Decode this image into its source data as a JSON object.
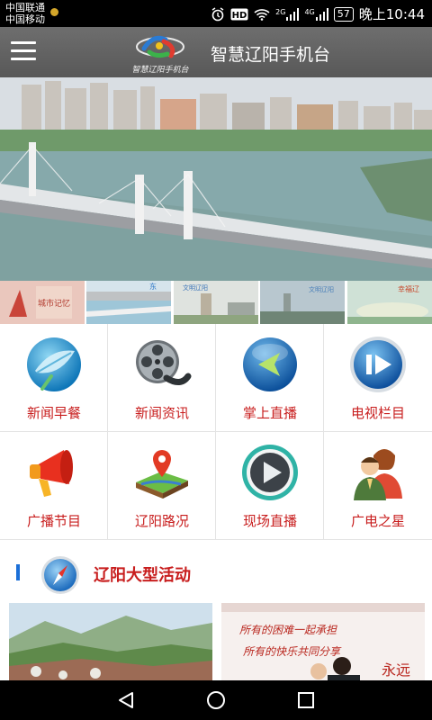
{
  "status_bar": {
    "carrier_1": "中国联通",
    "carrier_2": "中国移动",
    "network_2g": "2G",
    "network_4g": "4G",
    "battery": "57",
    "time": "晚上10:44"
  },
  "app_bar": {
    "title": "智慧辽阳手机台",
    "logo_text": "智慧辽阳手机台"
  },
  "thumbnails": [
    {
      "caption": "城市记忆",
      "tag": ""
    },
    {
      "caption": "",
      "tag": "东"
    },
    {
      "caption": "文明辽阳",
      "tag": ""
    },
    {
      "caption": "文明辽阳",
      "tag": ""
    },
    {
      "caption": "幸福辽",
      "tag": ""
    }
  ],
  "menu": [
    {
      "label": "新闻早餐",
      "icon": "leaf-icon"
    },
    {
      "label": "新闻资讯",
      "icon": "film-reel-icon"
    },
    {
      "label": "掌上直播",
      "icon": "back-arrow-icon"
    },
    {
      "label": "电视栏目",
      "icon": "pause-play-icon"
    },
    {
      "label": "广播节目",
      "icon": "megaphone-icon"
    },
    {
      "label": "辽阳路况",
      "icon": "map-pin-icon"
    },
    {
      "label": "现场直播",
      "icon": "play-icon"
    },
    {
      "label": "广电之星",
      "icon": "users-icon"
    }
  ],
  "section": {
    "title": "辽阳大型活动",
    "icon": "compass-icon"
  },
  "cards": [
    {
      "caption": ""
    },
    {
      "line1": "所有的困难一起承担",
      "line2": "所有的快乐共同分享",
      "side": "永远"
    }
  ],
  "colors": {
    "accent_red": "#c81d1d",
    "appbar_gray": "#616161",
    "section_blue": "#1b6fd8"
  }
}
